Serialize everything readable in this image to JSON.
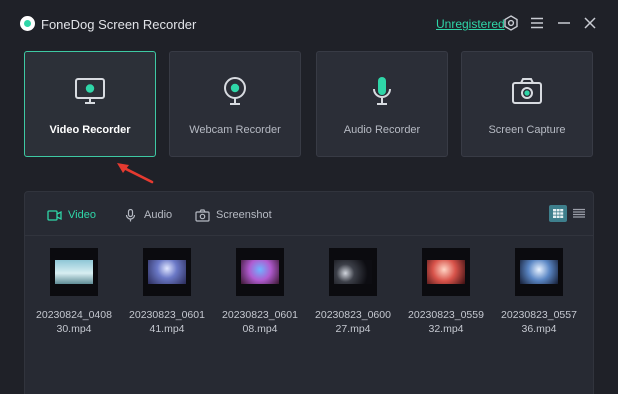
{
  "window": {
    "title": "FoneDog Screen Recorder",
    "register_link": "Unregistered"
  },
  "colors": {
    "accent": "#2fd6a8",
    "background": "#1f2128",
    "card": "#2b2e37",
    "arrow": "#e53a30"
  },
  "modes": [
    {
      "label": "Video Recorder",
      "icon": "monitor-icon",
      "selected": true
    },
    {
      "label": "Webcam Recorder",
      "icon": "webcam-icon",
      "selected": false
    },
    {
      "label": "Audio Recorder",
      "icon": "microphone-icon",
      "selected": false
    },
    {
      "label": "Screen Capture",
      "icon": "camera-icon",
      "selected": false
    }
  ],
  "library": {
    "tabs": [
      {
        "label": "Video",
        "icon": "video-camera-icon",
        "active": true
      },
      {
        "label": "Audio",
        "icon": "microphone-icon",
        "active": false
      },
      {
        "label": "Screenshot",
        "icon": "camera-icon",
        "active": false
      }
    ],
    "view_mode": "grid",
    "files": [
      {
        "name": "20230824_0408\n30.mp4"
      },
      {
        "name": "20230823_0601\n41.mp4"
      },
      {
        "name": "20230823_0601\n08.mp4"
      },
      {
        "name": "20230823_0600\n27.mp4"
      },
      {
        "name": "20230823_0559\n32.mp4"
      },
      {
        "name": "20230823_0557\n36.mp4"
      }
    ]
  }
}
